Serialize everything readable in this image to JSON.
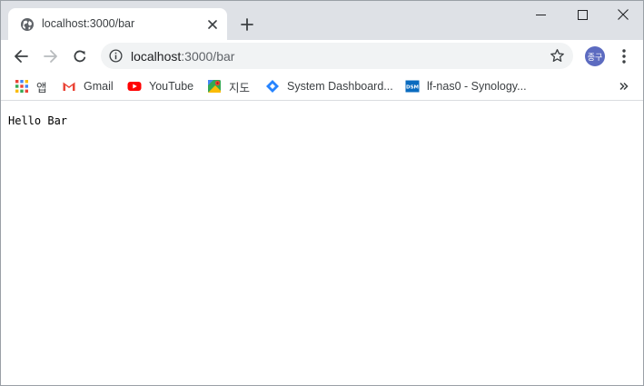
{
  "tab": {
    "title": "localhost:3000/bar",
    "favicon": "globe-icon"
  },
  "window_controls": [
    "minimize-icon",
    "maximize-icon",
    "close-icon"
  ],
  "address_bar": {
    "host": "localhost",
    "path": ":3000/bar"
  },
  "profile": {
    "avatar_text": "종구",
    "color": "#5c6bc0"
  },
  "bookmarks": [
    {
      "label": "앱",
      "icon": "apps-grid-icon"
    },
    {
      "label": "Gmail",
      "icon": "gmail-icon"
    },
    {
      "label": "YouTube",
      "icon": "youtube-icon"
    },
    {
      "label": "지도",
      "icon": "maps-icon"
    },
    {
      "label": "System Dashboard...",
      "icon": "jira-diamond-icon"
    },
    {
      "label": "lf-nas0 - Synology...",
      "icon": "dsm-icon"
    }
  ],
  "page": {
    "text": "Hello Bar"
  }
}
